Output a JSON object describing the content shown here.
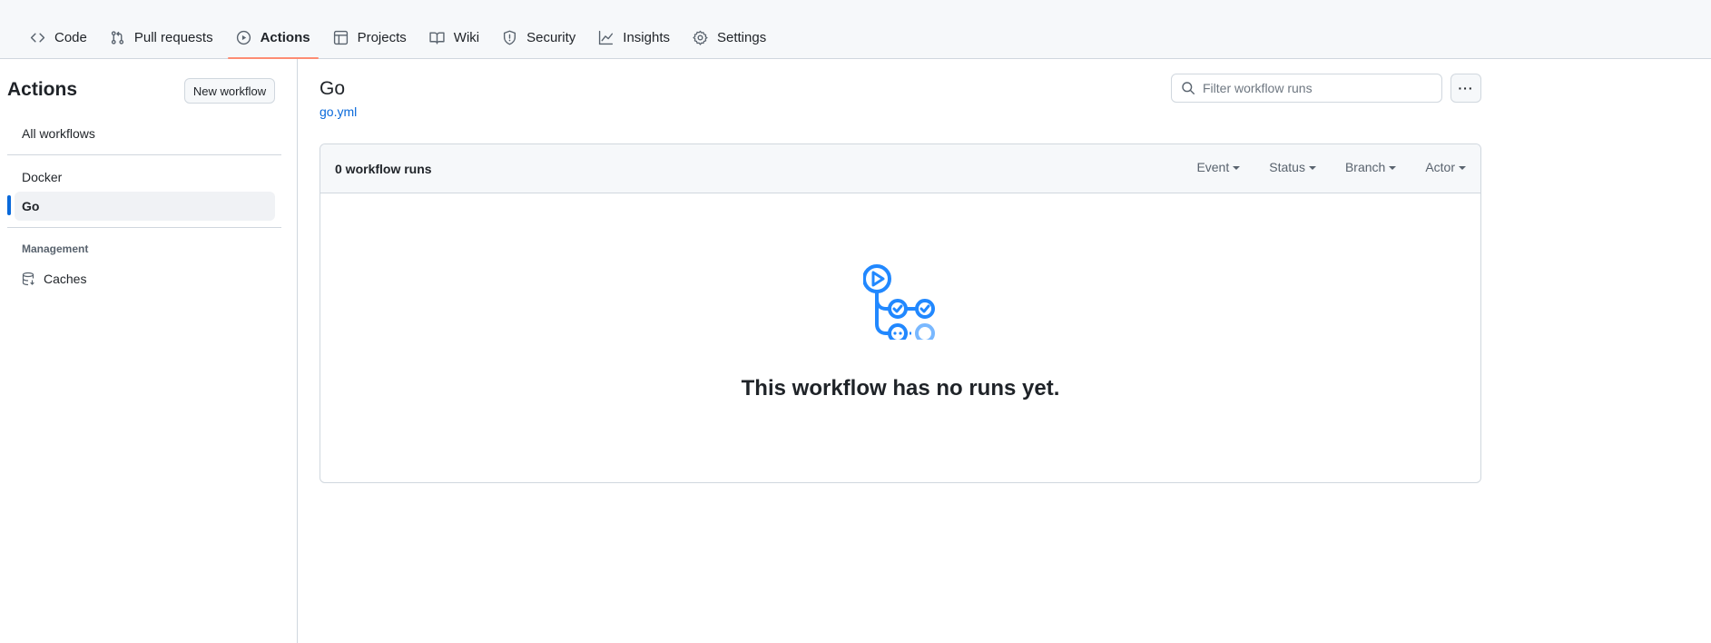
{
  "nav": {
    "tabs": [
      {
        "label": "Code",
        "icon": "code-icon"
      },
      {
        "label": "Pull requests",
        "icon": "pull-request-icon"
      },
      {
        "label": "Actions",
        "icon": "play-icon",
        "active": true
      },
      {
        "label": "Projects",
        "icon": "table-icon"
      },
      {
        "label": "Wiki",
        "icon": "book-icon"
      },
      {
        "label": "Security",
        "icon": "shield-icon"
      },
      {
        "label": "Insights",
        "icon": "graph-icon"
      },
      {
        "label": "Settings",
        "icon": "gear-icon"
      }
    ],
    "accent_color": "#fd8c73"
  },
  "sidebar": {
    "title": "Actions",
    "new_workflow_label": "New workflow",
    "all_workflows_label": "All workflows",
    "workflows": [
      {
        "label": "Docker"
      },
      {
        "label": "Go",
        "active": true
      }
    ],
    "management_label": "Management",
    "caches_label": "Caches",
    "active_color": "#0969da"
  },
  "main": {
    "title": "Go",
    "file_link": "go.yml",
    "search_placeholder": "Filter workflow runs",
    "more_label": "···",
    "runs_count": "0 workflow runs",
    "filters": [
      "Event",
      "Status",
      "Branch",
      "Actor"
    ],
    "empty_message": "This workflow has no runs yet.",
    "empty_icon": "workflow-graph-icon",
    "link_color": "#0969da",
    "icon_color": "#2188ff"
  }
}
